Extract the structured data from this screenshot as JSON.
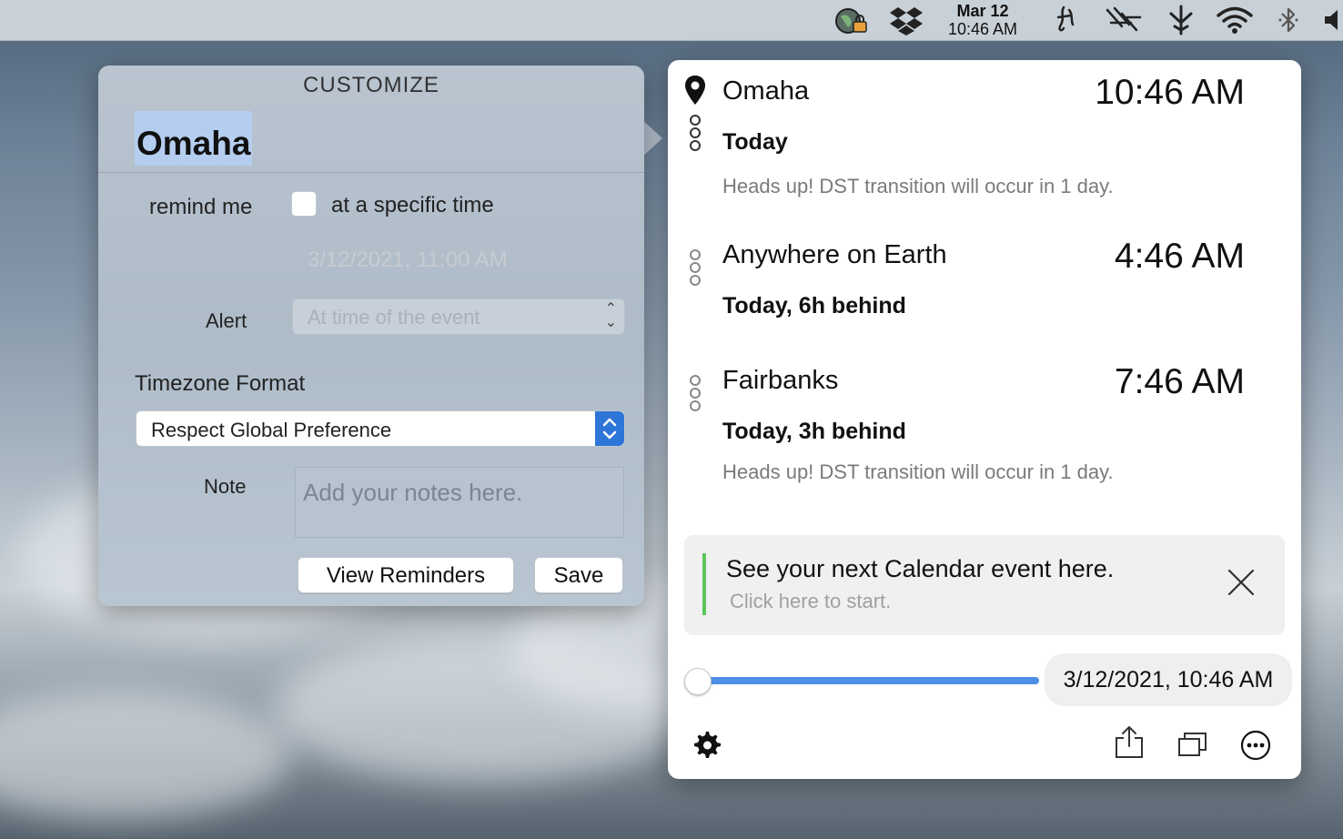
{
  "menubar": {
    "clock_date": "Mar 12",
    "clock_time": "10:46 AM",
    "icons": [
      "vpn-globe-lock-icon",
      "dropbox-icon",
      "typeface-icon",
      "antenna-icon",
      "sketch-icon",
      "wifi-icon",
      "bluetooth-icon",
      "volume-icon"
    ]
  },
  "customize": {
    "title": "CUSTOMIZE",
    "city": "Omaha",
    "remind_label": "remind me",
    "remind_option": "at a specific time",
    "remind_checked": false,
    "reminder_datetime": "3/12/2021, 11:00 AM",
    "alert_label": "Alert",
    "alert_value": "At time of the event",
    "timezone_format_label": "Timezone Format",
    "timezone_format_value": "Respect Global Preference",
    "note_label": "Note",
    "note_placeholder": "Add your notes here.",
    "view_reminders_button": "View Reminders",
    "save_button": "Save"
  },
  "panel": {
    "locations": [
      {
        "name": "Omaha",
        "time": "10:46 AM",
        "day": "Today",
        "note": "Heads up! DST transition will occur in 1 day."
      },
      {
        "name": "Anywhere on Earth",
        "time": "4:46 AM",
        "day": "Today, 6h behind",
        "note": ""
      },
      {
        "name": "Fairbanks",
        "time": "7:46 AM",
        "day": "Today, 3h behind",
        "note": "Heads up! DST transition will occur in 1 day."
      }
    ],
    "calendar_card": {
      "title": "See your next Calendar event here.",
      "subtitle": "Click here to start.",
      "accent_color": "#5cc55c"
    },
    "slider_fraction": 0.0,
    "slider_color": "#4f8ee7",
    "datetime_pill": "3/12/2021, 10:46 AM",
    "toolbar_icons": [
      "gear-icon",
      "share-icon",
      "windows-icon",
      "more-icon"
    ]
  }
}
